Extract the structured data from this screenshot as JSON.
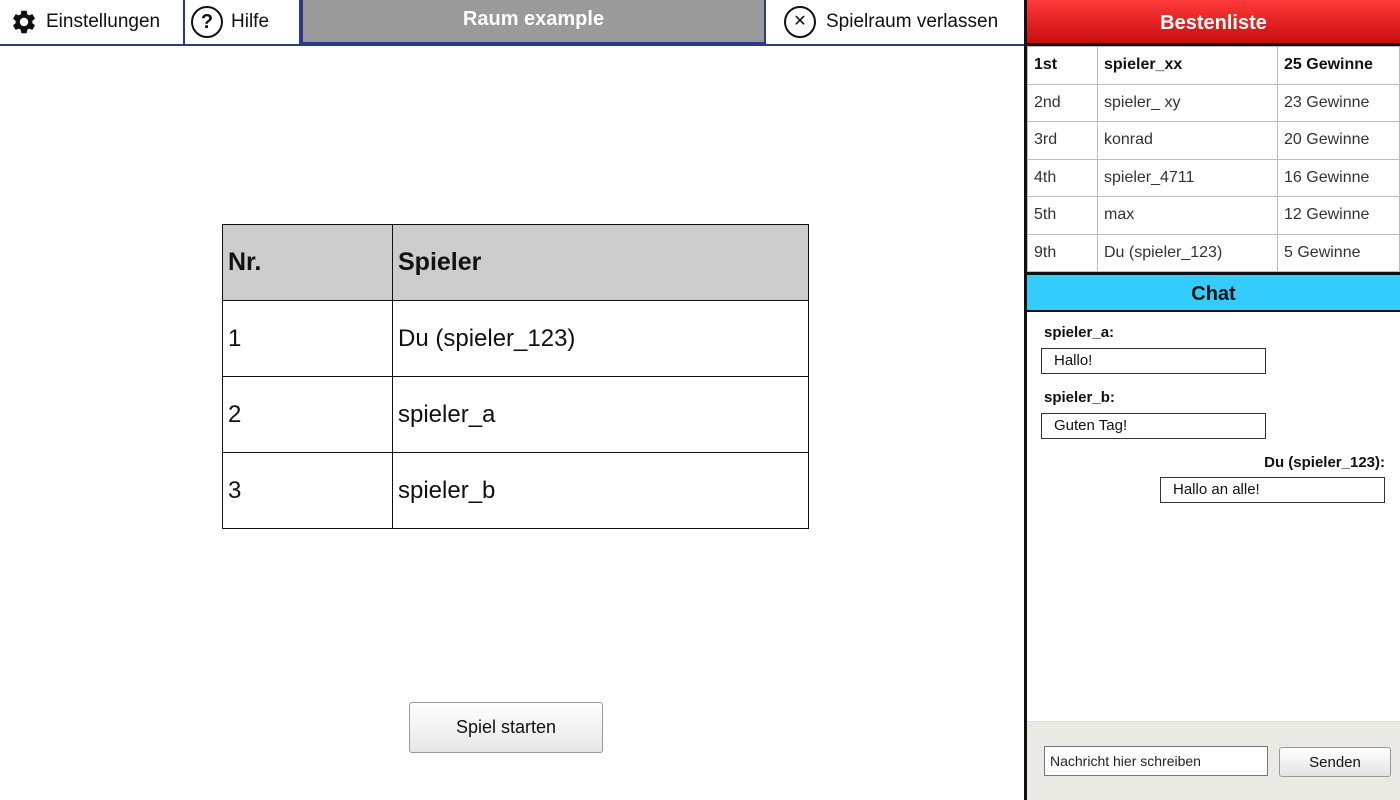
{
  "topbar": {
    "settings_label": "Einstellungen",
    "help_label": "Hilfe",
    "room_title": "Raum example",
    "leave_label": "Spielraum verlassen",
    "settings_icon": "gear-icon",
    "help_icon": "question-circle-icon",
    "leave_icon": "close-circle-icon"
  },
  "players": {
    "headers": [
      "Nr.",
      "Spieler"
    ],
    "rows": [
      {
        "nr": "1",
        "name": "Du (spieler_123)"
      },
      {
        "nr": "2",
        "name": "spieler_a"
      },
      {
        "nr": "3",
        "name": "spieler_b"
      }
    ]
  },
  "start_button": "Spiel starten",
  "leaderboard": {
    "title": "Bestenliste",
    "rows": [
      {
        "rank": "1st",
        "player": "spieler_xx",
        "wins": "25 Gewinne"
      },
      {
        "rank": "2nd",
        "player": "spieler_ xy",
        "wins": "23 Gewinne"
      },
      {
        "rank": "3rd",
        "player": "konrad",
        "wins": "20 Gewinne"
      },
      {
        "rank": "4th",
        "player": "spieler_4711",
        "wins": "16 Gewinne"
      },
      {
        "rank": "5th",
        "player": "max",
        "wins": "12 Gewinne"
      },
      {
        "rank": "9th",
        "player": "Du (spieler_123)",
        "wins": "5 Gewinne"
      }
    ]
  },
  "chat": {
    "title": "Chat",
    "messages": [
      {
        "sender": "spieler_a:",
        "text": "Hallo!"
      },
      {
        "sender": "spieler_b:",
        "text": "Guten Tag!"
      },
      {
        "sender": "Du (spieler_123):",
        "text": "Hallo an alle!"
      }
    ],
    "input_placeholder": "Nachricht hier schreiben",
    "send_label": "Senden"
  },
  "colors": {
    "leaderboard_header": "#e01a1a",
    "chat_header": "#33ccff",
    "room_title_bg": "#9a9a9a",
    "topbar_border": "#2a3a8a"
  }
}
